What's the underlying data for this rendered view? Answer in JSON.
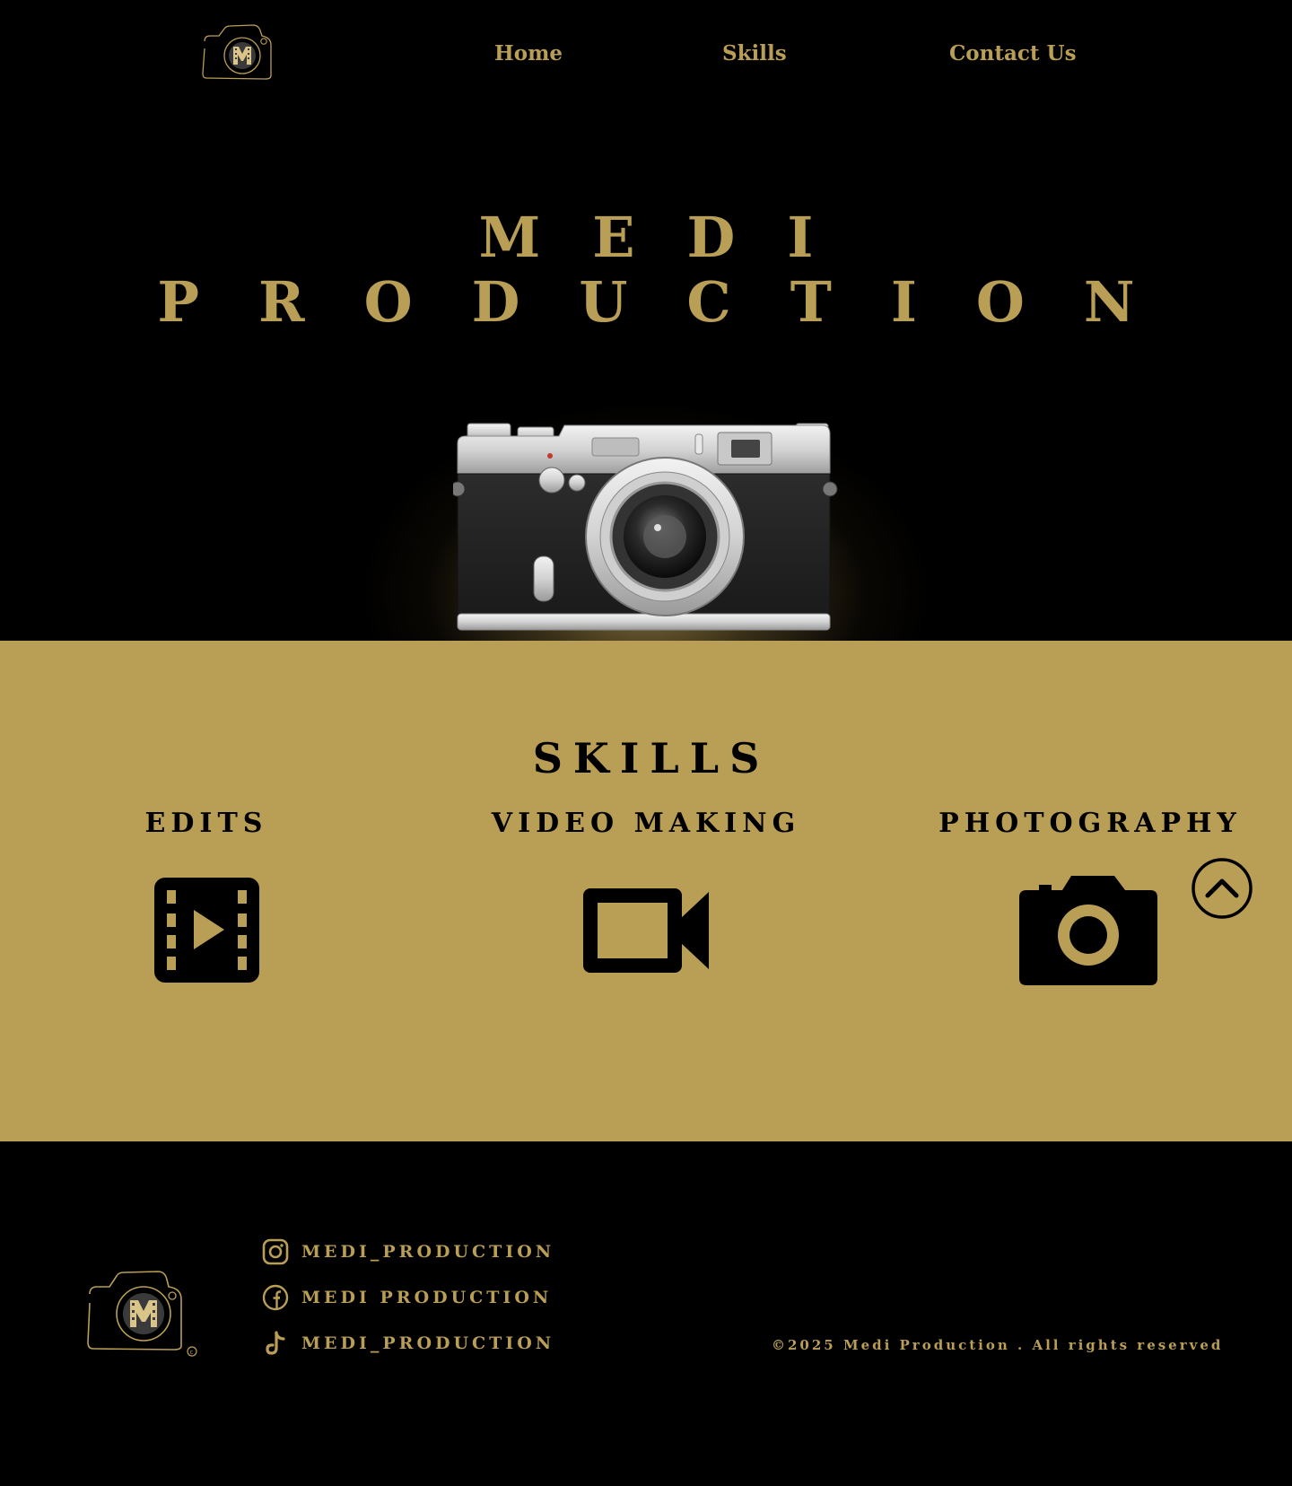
{
  "colors": {
    "accent": "#b99e56",
    "background": "#000000"
  },
  "nav": {
    "logo_icon": "camera-logo-icon",
    "links": [
      "Home",
      "Skills",
      "Contact Us"
    ]
  },
  "hero": {
    "title_line1": "MEDI",
    "title_line2": "PRODUCTION",
    "image": "vintage-rangefinder-camera"
  },
  "skills": {
    "title": "SKILLS",
    "items": [
      {
        "label": "EDITS",
        "icon": "film-play-icon"
      },
      {
        "label": "VIDEO MAKING",
        "icon": "video-camera-icon"
      },
      {
        "label": "PHOTOGRAPHY",
        "icon": "camera-icon"
      }
    ],
    "scroll_top_icon": "chevron-up-circle-icon"
  },
  "footer": {
    "logo_icon": "camera-logo-icon",
    "socials": [
      {
        "icon": "instagram-icon",
        "label": "MEDI_PRODUCTION"
      },
      {
        "icon": "facebook-icon",
        "label": "MEDI PRODUCTION"
      },
      {
        "icon": "tiktok-icon",
        "label": "MEDI_PRODUCTION"
      }
    ],
    "copyright": "©2025 Medi Production . All rights reserved"
  }
}
